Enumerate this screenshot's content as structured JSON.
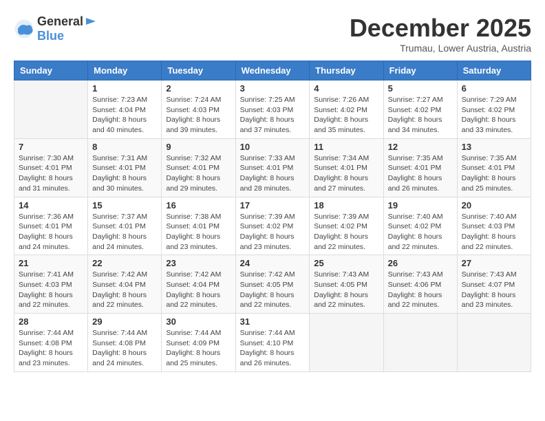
{
  "header": {
    "logo_general": "General",
    "logo_blue": "Blue",
    "month_title": "December 2025",
    "location": "Trumau, Lower Austria, Austria"
  },
  "weekdays": [
    "Sunday",
    "Monday",
    "Tuesday",
    "Wednesday",
    "Thursday",
    "Friday",
    "Saturday"
  ],
  "weeks": [
    [
      {
        "day": "",
        "sunrise": "",
        "sunset": "",
        "daylight": ""
      },
      {
        "day": "1",
        "sunrise": "Sunrise: 7:23 AM",
        "sunset": "Sunset: 4:04 PM",
        "daylight": "Daylight: 8 hours and 40 minutes."
      },
      {
        "day": "2",
        "sunrise": "Sunrise: 7:24 AM",
        "sunset": "Sunset: 4:03 PM",
        "daylight": "Daylight: 8 hours and 39 minutes."
      },
      {
        "day": "3",
        "sunrise": "Sunrise: 7:25 AM",
        "sunset": "Sunset: 4:03 PM",
        "daylight": "Daylight: 8 hours and 37 minutes."
      },
      {
        "day": "4",
        "sunrise": "Sunrise: 7:26 AM",
        "sunset": "Sunset: 4:02 PM",
        "daylight": "Daylight: 8 hours and 35 minutes."
      },
      {
        "day": "5",
        "sunrise": "Sunrise: 7:27 AM",
        "sunset": "Sunset: 4:02 PM",
        "daylight": "Daylight: 8 hours and 34 minutes."
      },
      {
        "day": "6",
        "sunrise": "Sunrise: 7:29 AM",
        "sunset": "Sunset: 4:02 PM",
        "daylight": "Daylight: 8 hours and 33 minutes."
      }
    ],
    [
      {
        "day": "7",
        "sunrise": "Sunrise: 7:30 AM",
        "sunset": "Sunset: 4:01 PM",
        "daylight": "Daylight: 8 hours and 31 minutes."
      },
      {
        "day": "8",
        "sunrise": "Sunrise: 7:31 AM",
        "sunset": "Sunset: 4:01 PM",
        "daylight": "Daylight: 8 hours and 30 minutes."
      },
      {
        "day": "9",
        "sunrise": "Sunrise: 7:32 AM",
        "sunset": "Sunset: 4:01 PM",
        "daylight": "Daylight: 8 hours and 29 minutes."
      },
      {
        "day": "10",
        "sunrise": "Sunrise: 7:33 AM",
        "sunset": "Sunset: 4:01 PM",
        "daylight": "Daylight: 8 hours and 28 minutes."
      },
      {
        "day": "11",
        "sunrise": "Sunrise: 7:34 AM",
        "sunset": "Sunset: 4:01 PM",
        "daylight": "Daylight: 8 hours and 27 minutes."
      },
      {
        "day": "12",
        "sunrise": "Sunrise: 7:35 AM",
        "sunset": "Sunset: 4:01 PM",
        "daylight": "Daylight: 8 hours and 26 minutes."
      },
      {
        "day": "13",
        "sunrise": "Sunrise: 7:35 AM",
        "sunset": "Sunset: 4:01 PM",
        "daylight": "Daylight: 8 hours and 25 minutes."
      }
    ],
    [
      {
        "day": "14",
        "sunrise": "Sunrise: 7:36 AM",
        "sunset": "Sunset: 4:01 PM",
        "daylight": "Daylight: 8 hours and 24 minutes."
      },
      {
        "day": "15",
        "sunrise": "Sunrise: 7:37 AM",
        "sunset": "Sunset: 4:01 PM",
        "daylight": "Daylight: 8 hours and 24 minutes."
      },
      {
        "day": "16",
        "sunrise": "Sunrise: 7:38 AM",
        "sunset": "Sunset: 4:01 PM",
        "daylight": "Daylight: 8 hours and 23 minutes."
      },
      {
        "day": "17",
        "sunrise": "Sunrise: 7:39 AM",
        "sunset": "Sunset: 4:02 PM",
        "daylight": "Daylight: 8 hours and 23 minutes."
      },
      {
        "day": "18",
        "sunrise": "Sunrise: 7:39 AM",
        "sunset": "Sunset: 4:02 PM",
        "daylight": "Daylight: 8 hours and 22 minutes."
      },
      {
        "day": "19",
        "sunrise": "Sunrise: 7:40 AM",
        "sunset": "Sunset: 4:02 PM",
        "daylight": "Daylight: 8 hours and 22 minutes."
      },
      {
        "day": "20",
        "sunrise": "Sunrise: 7:40 AM",
        "sunset": "Sunset: 4:03 PM",
        "daylight": "Daylight: 8 hours and 22 minutes."
      }
    ],
    [
      {
        "day": "21",
        "sunrise": "Sunrise: 7:41 AM",
        "sunset": "Sunset: 4:03 PM",
        "daylight": "Daylight: 8 hours and 22 minutes."
      },
      {
        "day": "22",
        "sunrise": "Sunrise: 7:42 AM",
        "sunset": "Sunset: 4:04 PM",
        "daylight": "Daylight: 8 hours and 22 minutes."
      },
      {
        "day": "23",
        "sunrise": "Sunrise: 7:42 AM",
        "sunset": "Sunset: 4:04 PM",
        "daylight": "Daylight: 8 hours and 22 minutes."
      },
      {
        "day": "24",
        "sunrise": "Sunrise: 7:42 AM",
        "sunset": "Sunset: 4:05 PM",
        "daylight": "Daylight: 8 hours and 22 minutes."
      },
      {
        "day": "25",
        "sunrise": "Sunrise: 7:43 AM",
        "sunset": "Sunset: 4:05 PM",
        "daylight": "Daylight: 8 hours and 22 minutes."
      },
      {
        "day": "26",
        "sunrise": "Sunrise: 7:43 AM",
        "sunset": "Sunset: 4:06 PM",
        "daylight": "Daylight: 8 hours and 22 minutes."
      },
      {
        "day": "27",
        "sunrise": "Sunrise: 7:43 AM",
        "sunset": "Sunset: 4:07 PM",
        "daylight": "Daylight: 8 hours and 23 minutes."
      }
    ],
    [
      {
        "day": "28",
        "sunrise": "Sunrise: 7:44 AM",
        "sunset": "Sunset: 4:08 PM",
        "daylight": "Daylight: 8 hours and 23 minutes."
      },
      {
        "day": "29",
        "sunrise": "Sunrise: 7:44 AM",
        "sunset": "Sunset: 4:08 PM",
        "daylight": "Daylight: 8 hours and 24 minutes."
      },
      {
        "day": "30",
        "sunrise": "Sunrise: 7:44 AM",
        "sunset": "Sunset: 4:09 PM",
        "daylight": "Daylight: 8 hours and 25 minutes."
      },
      {
        "day": "31",
        "sunrise": "Sunrise: 7:44 AM",
        "sunset": "Sunset: 4:10 PM",
        "daylight": "Daylight: 8 hours and 26 minutes."
      },
      {
        "day": "",
        "sunrise": "",
        "sunset": "",
        "daylight": ""
      },
      {
        "day": "",
        "sunrise": "",
        "sunset": "",
        "daylight": ""
      },
      {
        "day": "",
        "sunrise": "",
        "sunset": "",
        "daylight": ""
      }
    ]
  ]
}
